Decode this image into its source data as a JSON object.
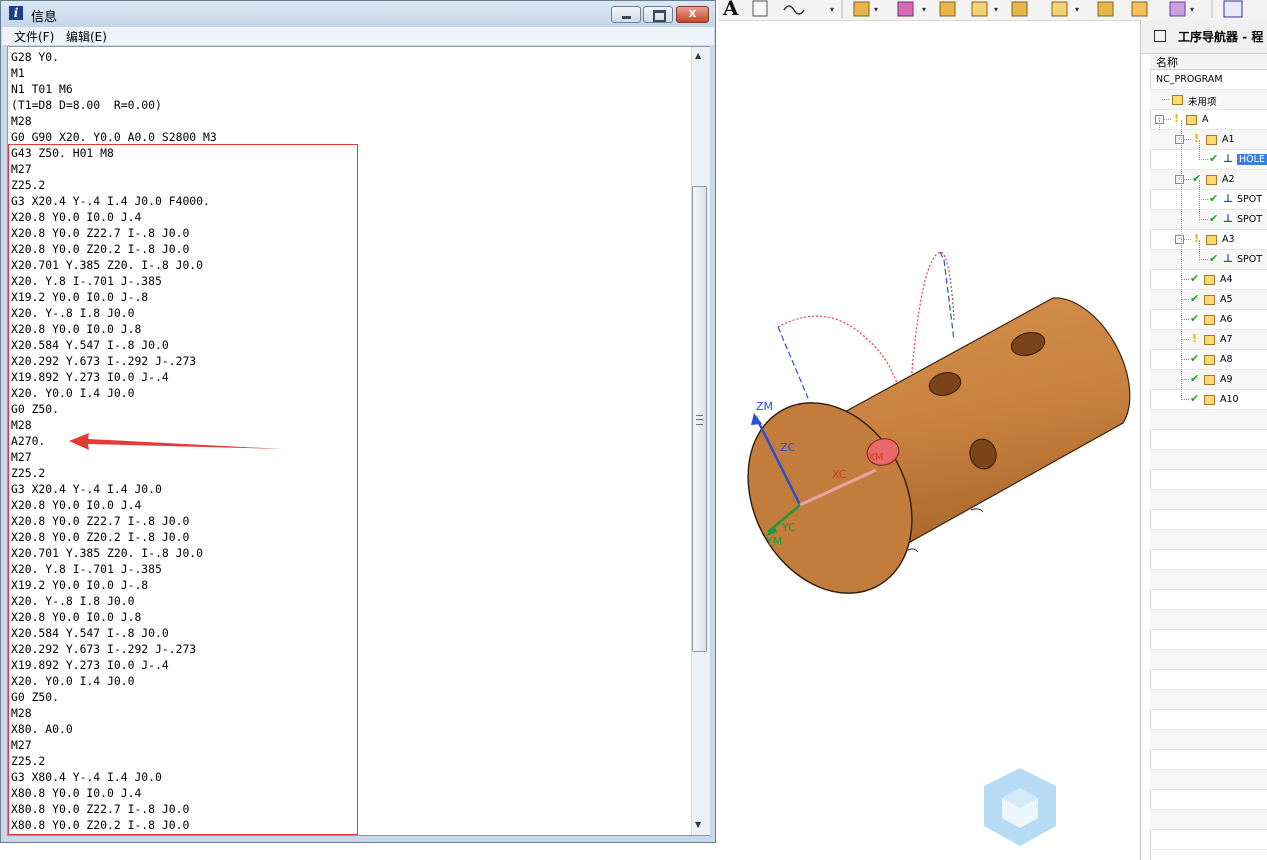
{
  "info_window": {
    "title": "信息",
    "title_icon": "i",
    "menu": {
      "file": "文件(F)",
      "edit": "编辑(E)"
    },
    "close_glyph": "x",
    "code_lines": [
      "G28 Y0.",
      "M1",
      "N1 T01 M6",
      "(T1=D8 D=8.00  R=0.00)",
      "M28",
      "G0 G90 X20. Y0.0 A0.0 S2800 M3",
      "G43 Z50. H01 M8",
      "M27",
      "Z25.2",
      "G3 X20.4 Y-.4 I.4 J0.0 F4000.",
      "X20.8 Y0.0 I0.0 J.4",
      "X20.8 Y0.0 Z22.7 I-.8 J0.0",
      "X20.8 Y0.0 Z20.2 I-.8 J0.0",
      "X20.701 Y.385 Z20. I-.8 J0.0",
      "X20. Y.8 I-.701 J-.385",
      "X19.2 Y0.0 I0.0 J-.8",
      "X20. Y-.8 I.8 J0.0",
      "X20.8 Y0.0 I0.0 J.8",
      "X20.584 Y.547 I-.8 J0.0",
      "X20.292 Y.673 I-.292 J-.273",
      "X19.892 Y.273 I0.0 J-.4",
      "X20. Y0.0 I.4 J0.0",
      "G0 Z50.",
      "M28",
      "A270.",
      "M27",
      "Z25.2",
      "G3 X20.4 Y-.4 I.4 J0.0",
      "X20.8 Y0.0 I0.0 J.4",
      "X20.8 Y0.0 Z22.7 I-.8 J0.0",
      "X20.8 Y0.0 Z20.2 I-.8 J0.0",
      "X20.701 Y.385 Z20. I-.8 J0.0",
      "X20. Y.8 I-.701 J-.385",
      "X19.2 Y0.0 I0.0 J-.8",
      "X20. Y-.8 I.8 J0.0",
      "X20.8 Y0.0 I0.0 J.8",
      "X20.584 Y.547 I-.8 J0.0",
      "X20.292 Y.673 I-.292 J-.273",
      "X19.892 Y.273 I0.0 J-.4",
      "X20. Y0.0 I.4 J0.0",
      "G0 Z50.",
      "M28",
      "X80. A0.0",
      "M27",
      "Z25.2",
      "G3 X80.4 Y-.4 I.4 J0.0",
      "X80.8 Y0.0 I0.0 J.4",
      "X80.8 Y0.0 Z22.7 I-.8 J0.0",
      "X80.8 Y0.0 Z20.2 I-.8 J0.0"
    ]
  },
  "viewport": {
    "axis_labels": {
      "zm": "ZM",
      "zc": "ZC",
      "xc": "XC",
      "xm": "XM",
      "yc": "YC",
      "ym": "YM"
    },
    "part_color": "#c8813f",
    "annotation_color": "#e53935"
  },
  "toolbar": {
    "text_tool": "A"
  },
  "navigator": {
    "title": "工序导航器 - 程",
    "column_name": "名称",
    "rows": [
      {
        "label": "NC_PROGRAM",
        "status": "none"
      },
      {
        "label": "未用项",
        "status": "none"
      },
      {
        "label": "A",
        "status": "warn"
      },
      {
        "label": "A1",
        "status": "warn"
      },
      {
        "label": "HOLE",
        "status": "ok",
        "selected": true
      },
      {
        "label": "A2",
        "status": "ok"
      },
      {
        "label": "SPOT",
        "status": "ok"
      },
      {
        "label": "SPOT",
        "status": "ok"
      },
      {
        "label": "A3",
        "status": "warn"
      },
      {
        "label": "SPOT",
        "status": "ok"
      },
      {
        "label": "A4",
        "status": "ok"
      },
      {
        "label": "A5",
        "status": "ok"
      },
      {
        "label": "A6",
        "status": "ok"
      },
      {
        "label": "A7",
        "status": "warn"
      },
      {
        "label": "A8",
        "status": "ok"
      },
      {
        "label": "A9",
        "status": "ok"
      },
      {
        "label": "A10",
        "status": "ok"
      }
    ]
  }
}
